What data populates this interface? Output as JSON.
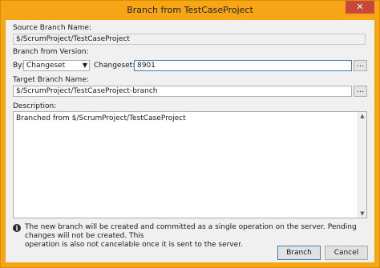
{
  "window": {
    "title": "Branch from TestCaseProject",
    "close_label": "✕"
  },
  "source": {
    "label": "Source Branch Name:",
    "value": "$/ScrumProject/TestCaseProject"
  },
  "version": {
    "label": "Branch from Version:",
    "by_label": "By:",
    "by_value": "Changeset",
    "changeset_label": "Changeset:",
    "changeset_value": "8901",
    "browse_label": "..."
  },
  "target": {
    "label": "Target Branch Name:",
    "value": "$/ScrumProject/TestCaseProject-branch",
    "browse_label": "..."
  },
  "description": {
    "label": "Description:",
    "value": "Branched from $/ScrumProject/TestCaseProject"
  },
  "info": {
    "icon": "info-icon",
    "line1": "The new branch will be created and committed as a single operation on the server. Pending changes will not be created. This",
    "line2": "operation is also not cancelable once it is sent to the server."
  },
  "buttons": {
    "branch": "Branch",
    "cancel": "Cancel"
  }
}
